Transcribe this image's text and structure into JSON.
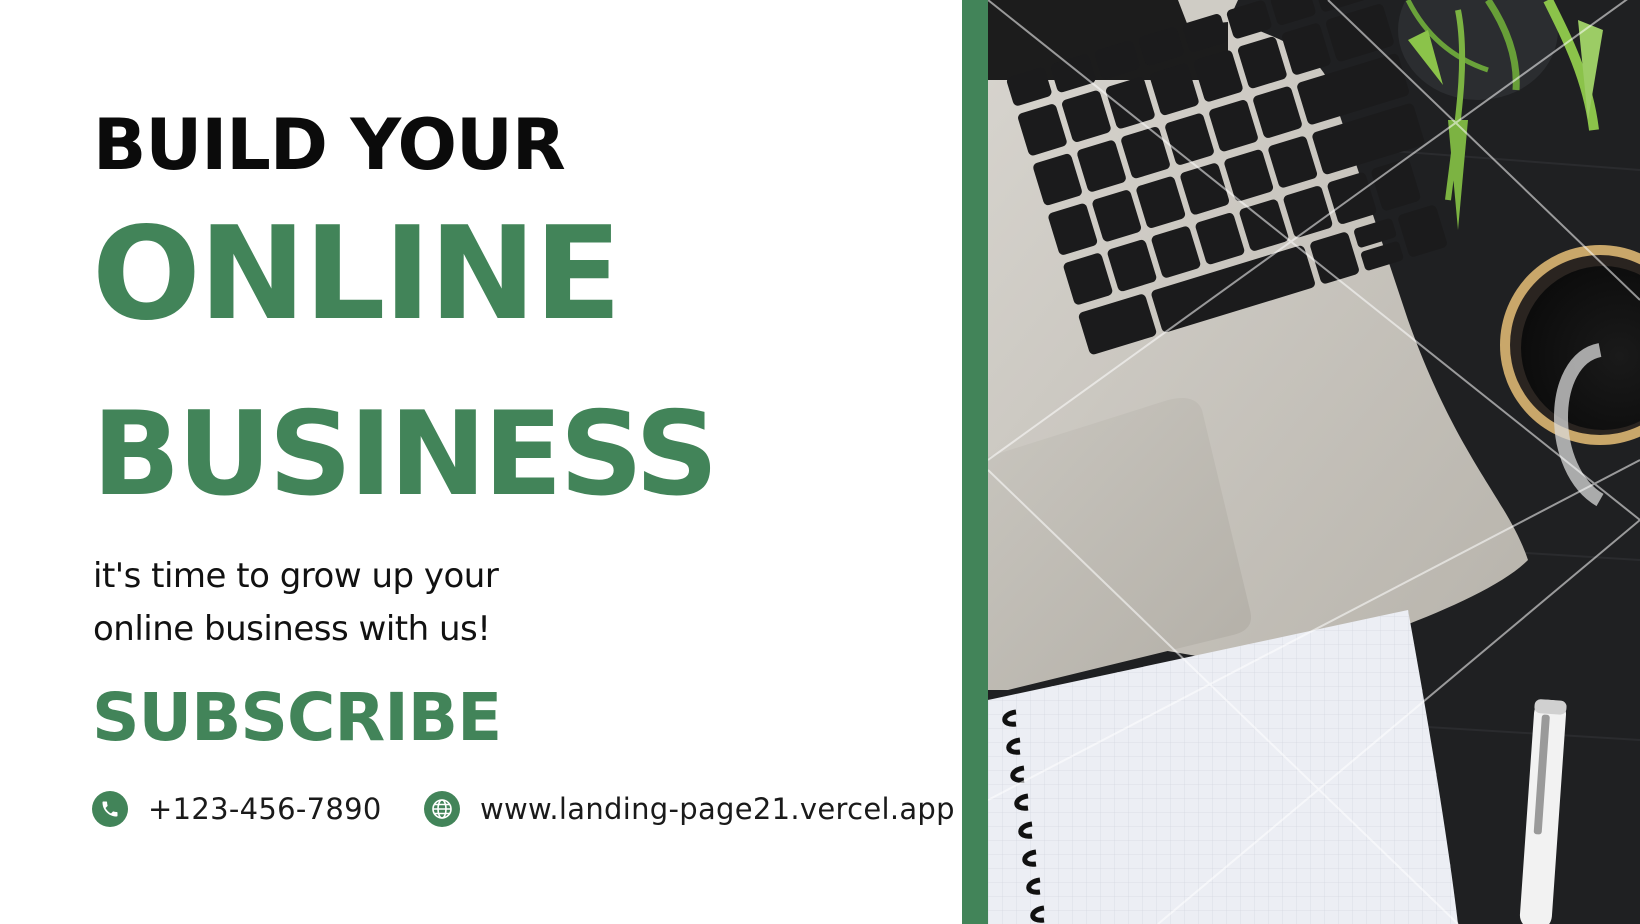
{
  "headline": {
    "line1": "BUILD YOUR",
    "line2": "ONLINE",
    "line3": "BUSINESS"
  },
  "tagline": {
    "line1": "it's time to grow up your",
    "line2": "online business with us!"
  },
  "cta": {
    "label": "SUBSCRIBE"
  },
  "contact": {
    "phone": "+123-456-7890",
    "phone_icon": "phone-icon",
    "website": "www.landing-page21.vercel.app",
    "website_icon": "globe-icon"
  },
  "photo": {
    "subject": "laptop-notebook-coffee-photo"
  },
  "colors": {
    "brand_green": "#428459",
    "text_dark": "#0b0b0b",
    "background": "#ffffff"
  }
}
